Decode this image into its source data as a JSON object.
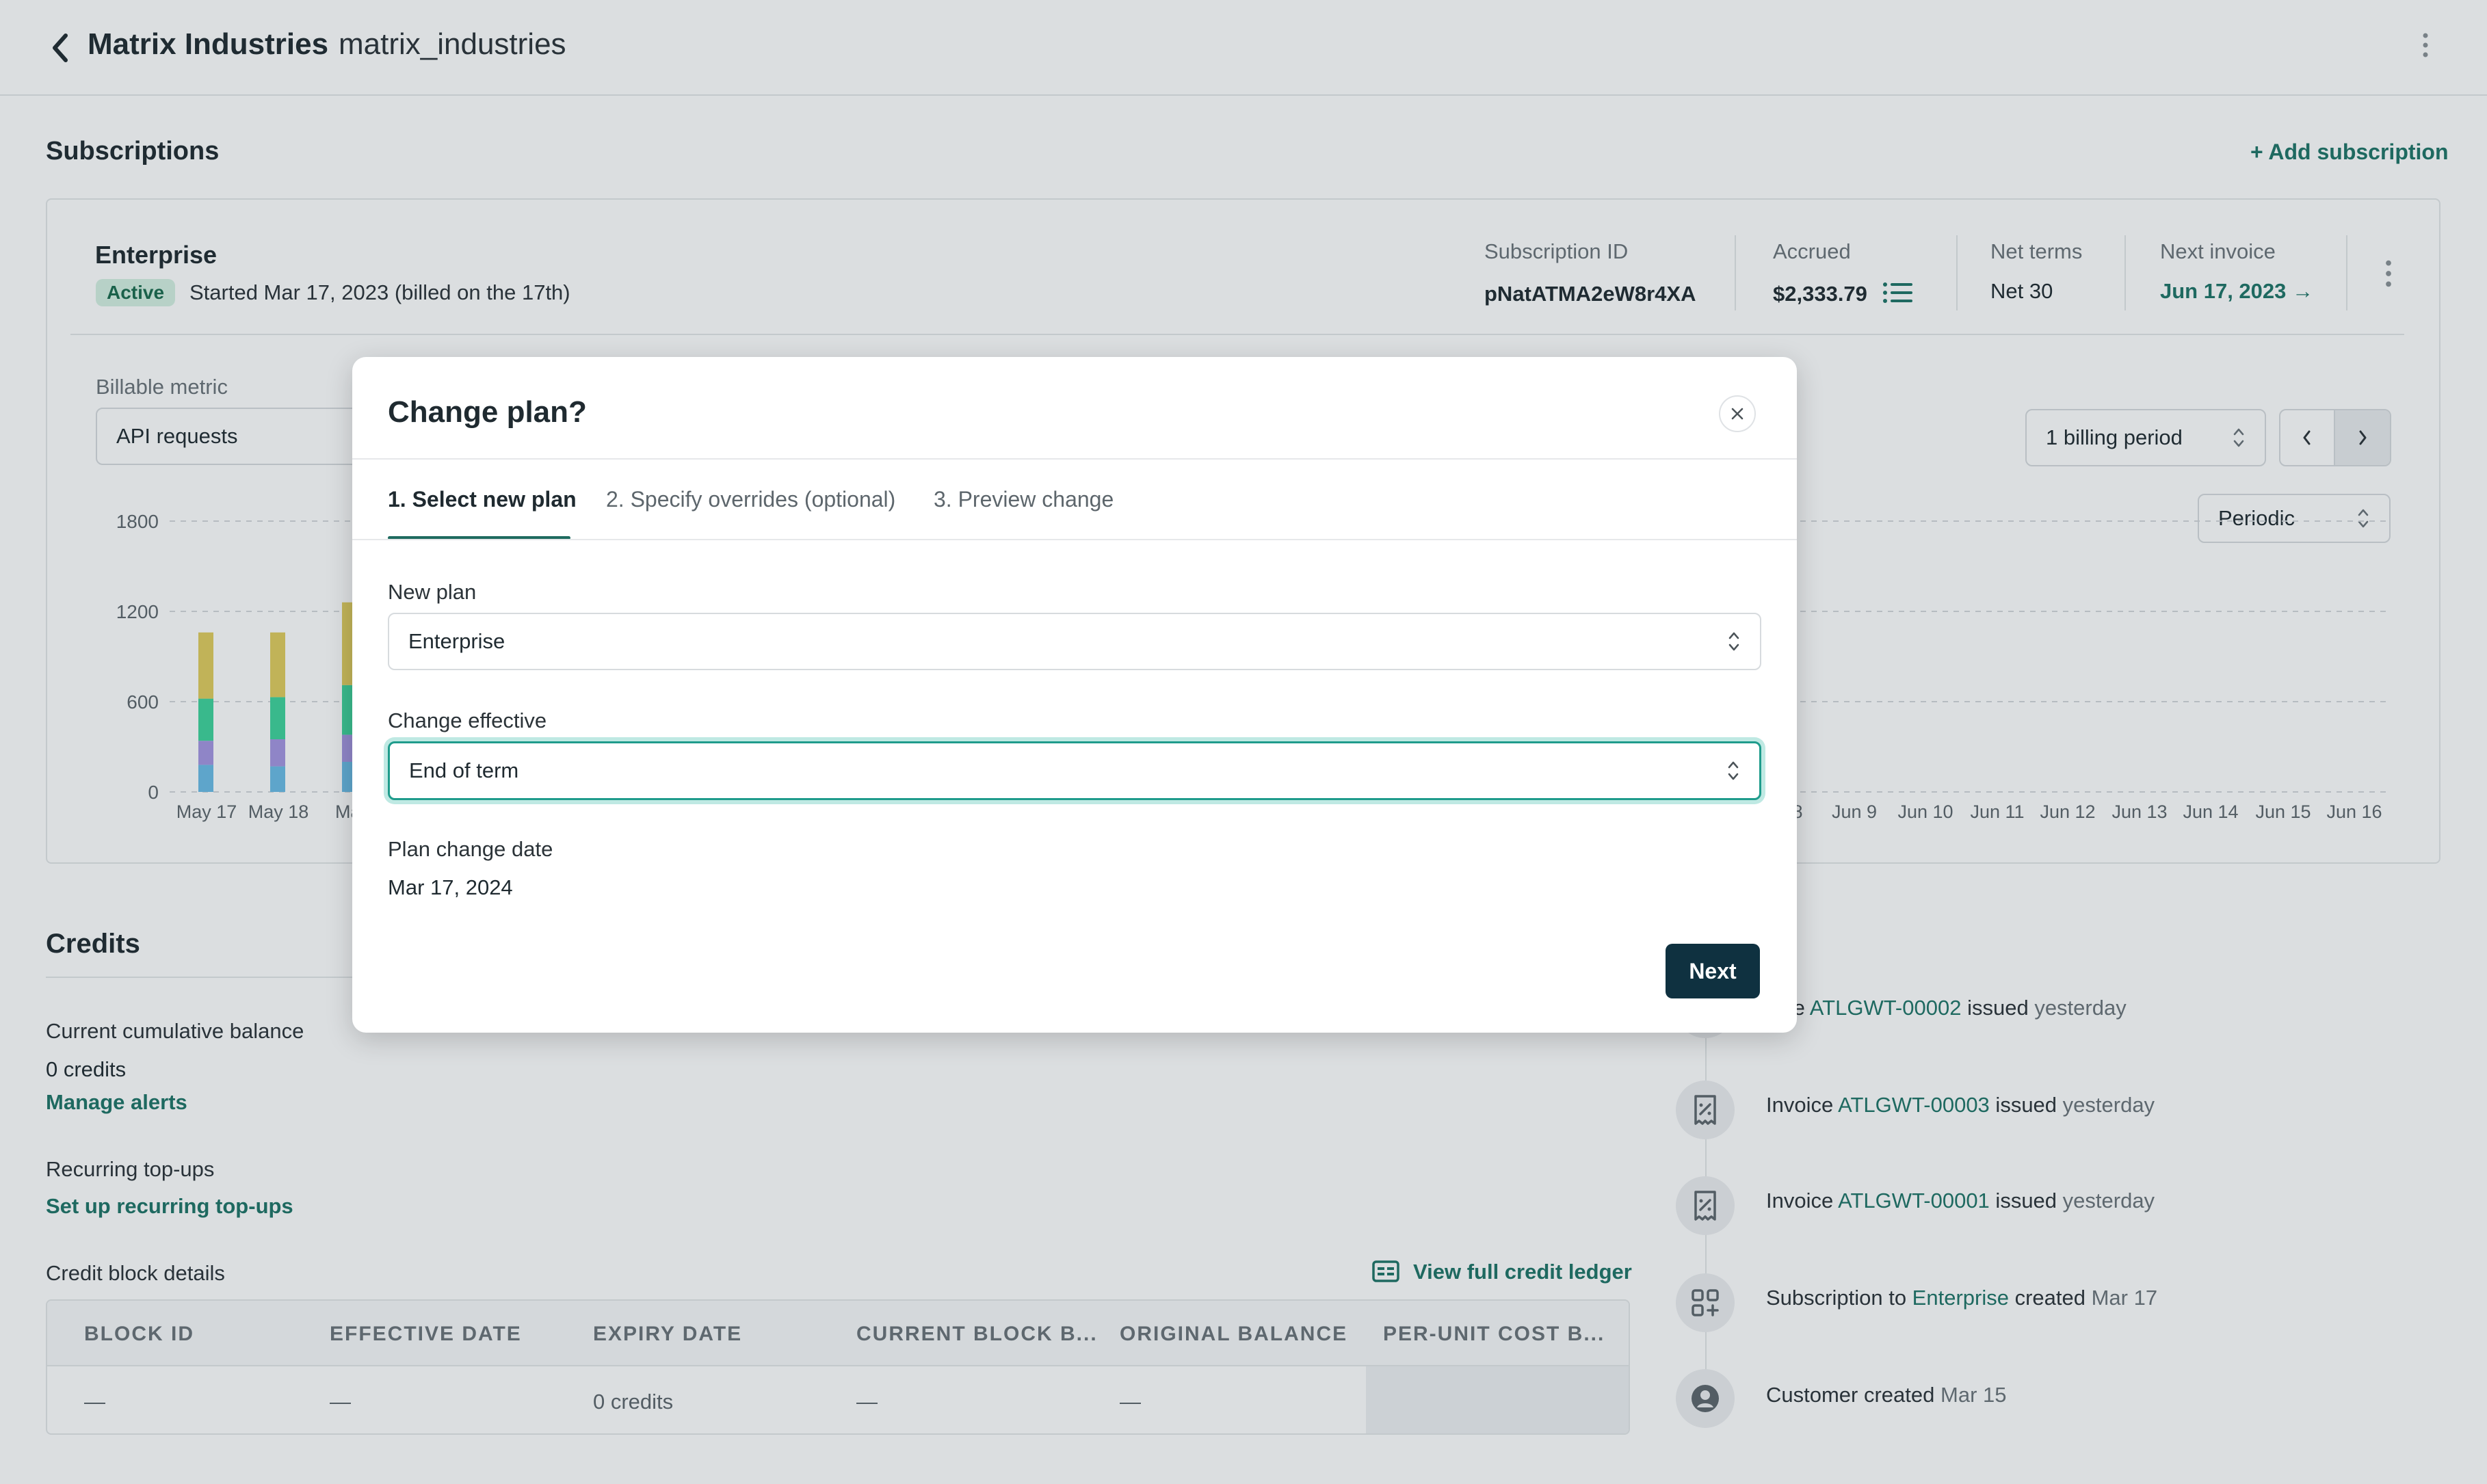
{
  "header": {
    "title": "Matrix Industries",
    "slug": "matrix_industries"
  },
  "subscriptions": {
    "title": "Subscriptions",
    "add_label": "+ Add subscription",
    "card": {
      "plan_name": "Enterprise",
      "status": "Active",
      "started": "Started Mar 17, 2023 (billed on the 17th)",
      "subscription_id_label": "Subscription ID",
      "subscription_id": "pNatATMA2eW8r4XA",
      "accrued_label": "Accrued",
      "accrued": "$2,333.79",
      "net_terms_label": "Net terms",
      "net_terms": "Net 30",
      "next_invoice_label": "Next invoice",
      "next_invoice": "Jun 17, 2023 →",
      "billable_metric_label": "Billable metric",
      "billable_metric": "API requests",
      "billing_period": "1 billing period",
      "periodic": "Periodic"
    }
  },
  "chart_data": {
    "type": "bar",
    "y_ticks": [
      "1800",
      "1200",
      "600",
      "0"
    ],
    "ylim": [
      0,
      1800
    ],
    "categories_left": [
      "May 17",
      "May 18",
      "May"
    ],
    "categories_right": [
      "8",
      "Jun 9",
      "Jun 10",
      "Jun 11",
      "Jun 12",
      "Jun 13",
      "Jun 14",
      "Jun 15",
      "Jun 16"
    ],
    "stacks": [
      {
        "segments": [
          180,
          160,
          280,
          440
        ]
      },
      {
        "segments": [
          170,
          180,
          280,
          430
        ]
      },
      {
        "segments": [
          200,
          180,
          330,
          550
        ]
      }
    ],
    "colors": [
      "#6bbce6",
      "#a596e2",
      "#3fd39b",
      "#e0cc5e"
    ]
  },
  "credits": {
    "title": "Credits",
    "balance_label": "Current cumulative balance",
    "balance": "0 credits",
    "manage_alerts": "Manage alerts",
    "topups_label": "Recurring top-ups",
    "topups_link": "Set up recurring top-ups",
    "block_details_label": "Credit block details",
    "ledger_link": "View full credit ledger",
    "columns": [
      "BLOCK ID",
      "EFFECTIVE DATE",
      "EXPIRY DATE",
      "CURRENT BLOCK B...",
      "ORIGINAL BALANCE",
      "PER-UNIT COST B..."
    ],
    "row": [
      "—",
      "—",
      "0 credits",
      "—",
      "—",
      ""
    ]
  },
  "timeline": [
    {
      "pre": "oice ",
      "link": "ATLGWT-00002",
      "post": " issued ",
      "when": "yesterday"
    },
    {
      "pre": "Invoice ",
      "link": "ATLGWT-00003",
      "post": " issued ",
      "when": "yesterday"
    },
    {
      "pre": "Invoice ",
      "link": "ATLGWT-00001",
      "post": " issued ",
      "when": "yesterday"
    },
    {
      "pre": "Subscription to ",
      "link": "Enterprise",
      "post": " created ",
      "when": "Mar 17"
    },
    {
      "pre": "Customer created ",
      "link": "",
      "post": "",
      "when": "Mar 15"
    }
  ],
  "modal": {
    "title": "Change plan?",
    "tabs": [
      "1. Select new plan",
      "2. Specify overrides (optional)",
      "3. Preview change"
    ],
    "new_plan_label": "New plan",
    "new_plan_value": "Enterprise",
    "change_effective_label": "Change effective",
    "change_effective_value": "End of term",
    "plan_change_date_label": "Plan change date",
    "plan_change_date": "Mar 17, 2024",
    "next_label": "Next"
  }
}
